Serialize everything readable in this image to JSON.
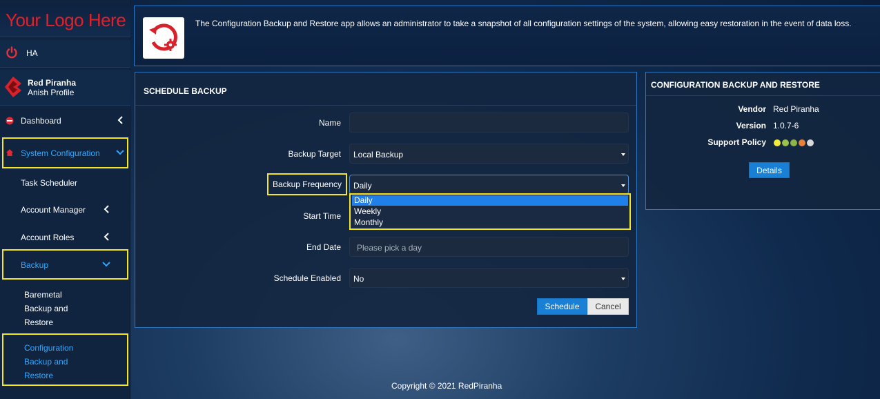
{
  "brand": {
    "logo_text": "Your Logo Here"
  },
  "sidebar": {
    "ha_label": "HA",
    "user": {
      "name": "Red Piranha",
      "profile": "Anish Profile"
    },
    "items": [
      {
        "label": "Dashboard"
      },
      {
        "label": "System Configuration"
      },
      {
        "label": "Task Scheduler"
      },
      {
        "label": "Account Manager"
      },
      {
        "label": "Account Roles"
      },
      {
        "label": "Backup"
      },
      {
        "label_lines": [
          "Baremetal",
          "Backup and",
          "Restore"
        ]
      },
      {
        "label_lines": [
          "Configuration",
          "Backup and",
          "Restore"
        ]
      }
    ]
  },
  "header": {
    "description": "The Configuration Backup and Restore app allows an administrator to take a snapshot of all configuration settings of the system, allowing easy restoration in the event of data loss."
  },
  "schedule_panel": {
    "title": "SCHEDULE BACKUP",
    "fields": {
      "name": {
        "label": "Name",
        "value": ""
      },
      "backup_target": {
        "label": "Backup Target",
        "value": "Local Backup"
      },
      "backup_frequency": {
        "label": "Backup Frequency",
        "value": "Daily",
        "options": [
          "Daily",
          "Weekly",
          "Monthly"
        ],
        "selected": "Daily"
      },
      "start_time": {
        "label": "Start Time"
      },
      "end_date": {
        "label": "End Date",
        "placeholder": "Please pick a day"
      },
      "schedule_enabled": {
        "label": "Schedule Enabled",
        "value": "No"
      }
    },
    "buttons": {
      "schedule": "Schedule",
      "cancel": "Cancel"
    }
  },
  "info_panel": {
    "title": "CONFIGURATION BACKUP AND RESTORE",
    "vendor": {
      "label": "Vendor",
      "value": "Red Piranha"
    },
    "version": {
      "label": "Version",
      "value": "1.0.7-6"
    },
    "support_policy": {
      "label": "Support Policy",
      "dot_colors": [
        "#f2e93a",
        "#9bc14b",
        "#8db44a",
        "#e8823a",
        "#d9d9d9"
      ]
    },
    "details_button": "Details"
  },
  "footer": {
    "copyright": "Copyright © 2021 RedPiranha"
  },
  "colors": {
    "accent": "#1a80d6",
    "highlight": "#f5e625",
    "brand_red": "#e0202a",
    "active_link": "#2ea8ff"
  }
}
